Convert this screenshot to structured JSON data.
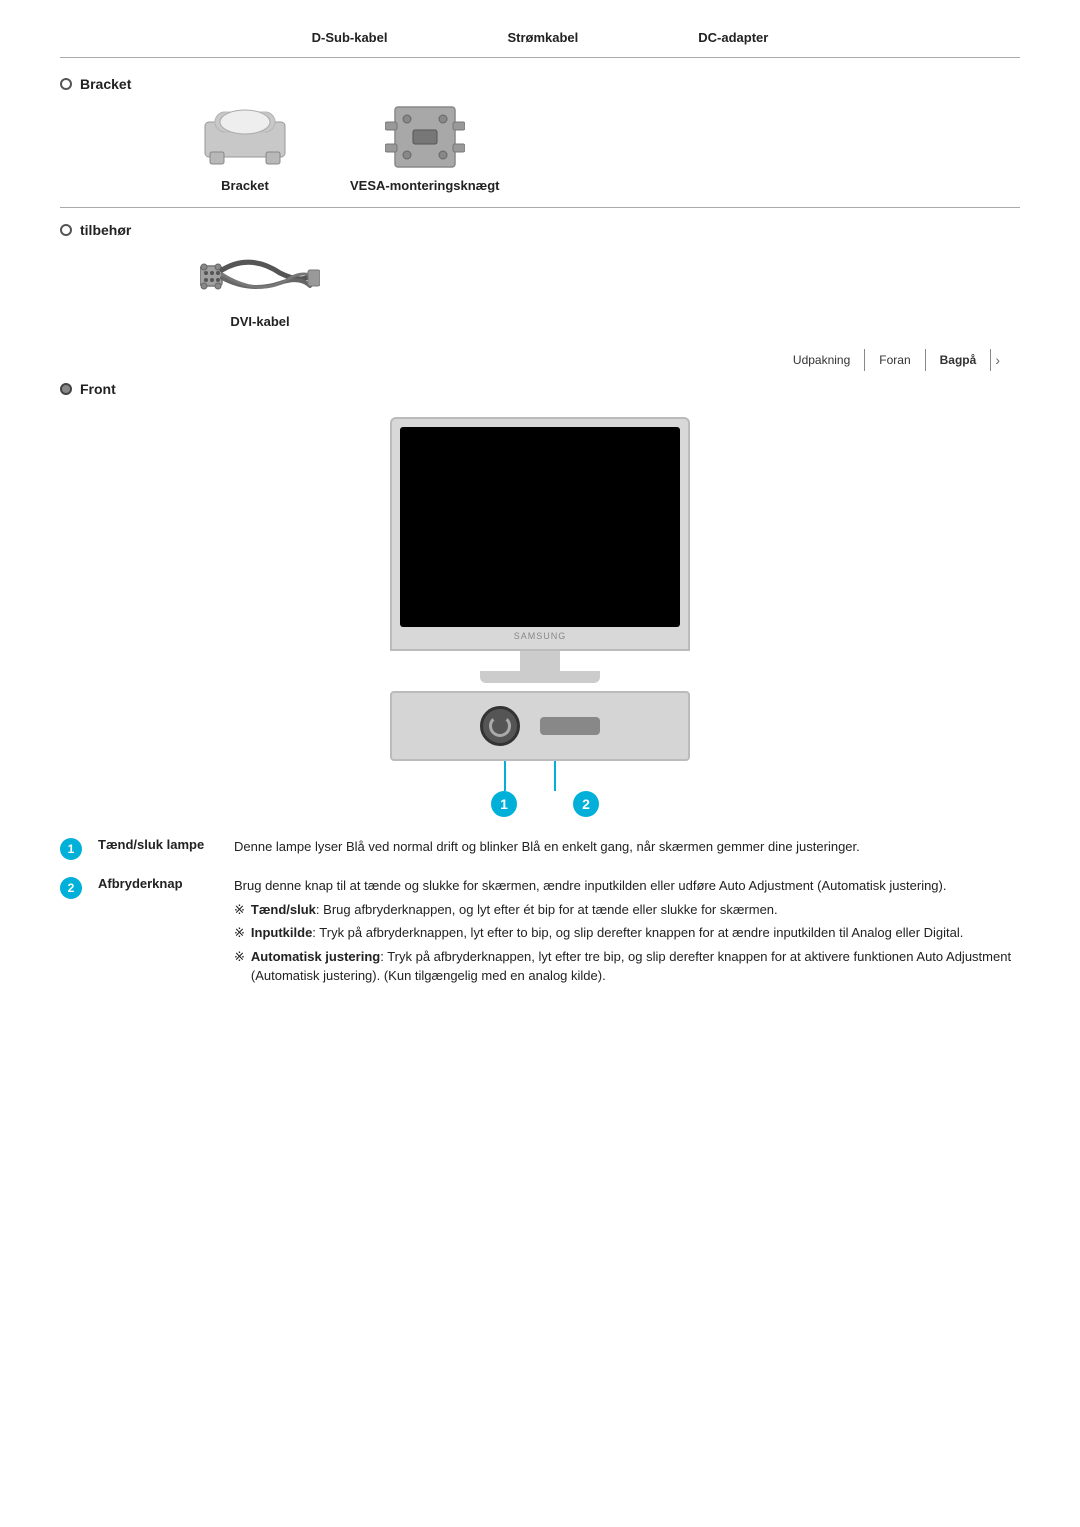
{
  "header": {
    "items": [
      "D-Sub-kabel",
      "Strømkabel",
      "DC-adapter"
    ]
  },
  "sections": [
    {
      "id": "bracket",
      "title": "Bracket",
      "items": [
        {
          "label": "Bracket"
        },
        {
          "label": "VESA-monteringsknægt"
        }
      ]
    },
    {
      "id": "tilbehor",
      "title": "tilbehør",
      "items": [
        {
          "label": "DVI-kabel"
        }
      ]
    }
  ],
  "nav": {
    "items": [
      "Udpakning",
      "Foran",
      "Bagpå"
    ]
  },
  "front": {
    "title": "Front"
  },
  "descriptions": [
    {
      "number": "1",
      "title": "Tænd/sluk lampe",
      "text": "Denne lampe lyser Blå ved normal drift og blinker Blå en enkelt gang, når skærmen gemmer dine justeringer."
    },
    {
      "number": "2",
      "title": "Afbryderknap",
      "text": "Brug denne knap til at tænde og slukke for skærmen, ændre inputkilden eller udføre Auto Adjustment (Automatisk justering).",
      "bullets": [
        {
          "label": "Tænd/sluk",
          "text": ": Brug afbryderknappen, og lyt efter ét bip for at tænde eller slukke for skærmen."
        },
        {
          "label": "Inputkilde",
          "text": ": Tryk på afbryderknappen, lyt efter to bip, og slip derefter knappen for at ændre inputkilden til Analog eller Digital."
        },
        {
          "label": "Automatisk justering",
          "text": ": Tryk på afbryderknappen, lyt efter tre bip, og slip derefter knappen for at aktivere funktionen Auto Adjustment (Automatisk justering). (Kun tilgængelig med en analog kilde)."
        }
      ]
    }
  ]
}
